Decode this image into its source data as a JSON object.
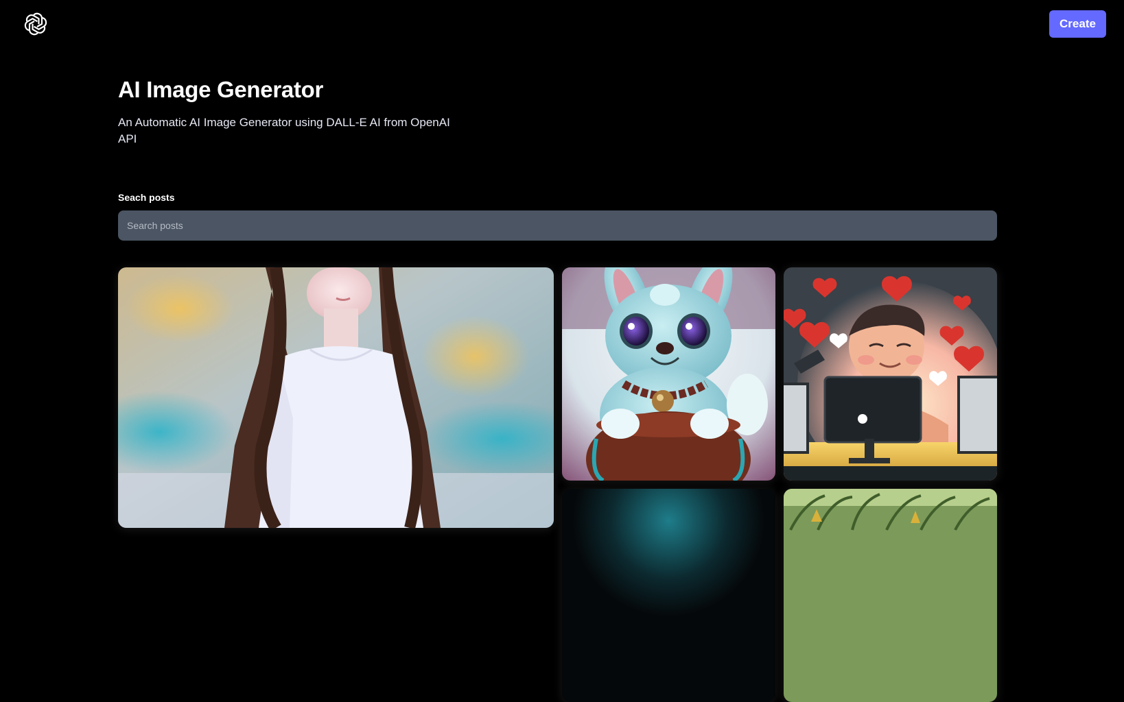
{
  "app": {
    "logo_icon": "openai-logo-icon",
    "create_label": "Create",
    "accent_color": "#6469ff"
  },
  "hero": {
    "title": "AI Image Generator",
    "subtitle": "An Automatic AI Image Generator using DALL-E AI from OpenAI API"
  },
  "search": {
    "label": "Seach posts",
    "placeholder": "Search posts",
    "value": ""
  },
  "gallery": {
    "cards": [
      {
        "image": "woman-portrait-image"
      },
      {
        "image": "cartoon-bunny-image"
      },
      {
        "image": "man-with-hearts-computer-image"
      },
      {
        "image": "dark-teal-image"
      },
      {
        "image": "cornfield-image"
      }
    ]
  }
}
